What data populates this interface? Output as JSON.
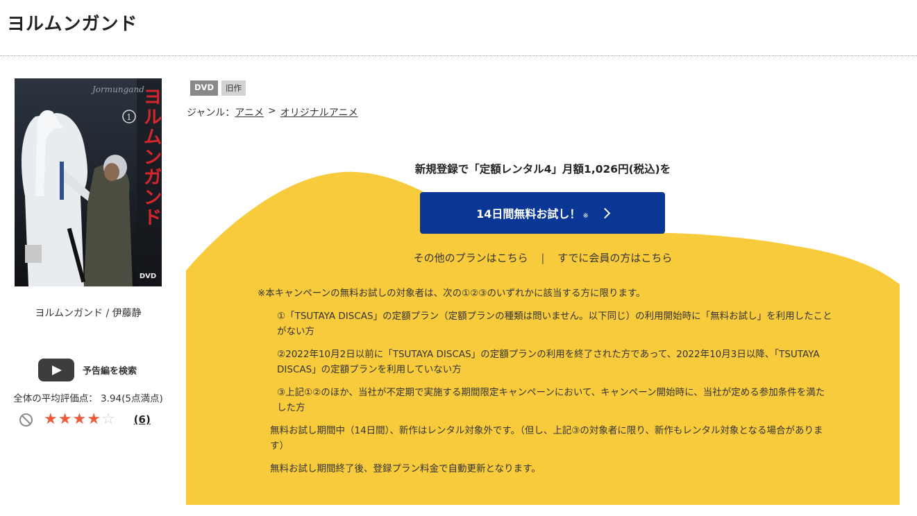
{
  "page": {
    "title": "ヨルムンガンド"
  },
  "jacket": {
    "title_text": "ヨルムンガンド",
    "number": "1",
    "en_text": "Jormungand",
    "dvd_mark": "DVD"
  },
  "work": {
    "credit": "ヨルムンガンド / 伊藤静"
  },
  "trailer": {
    "label": "予告編を検索",
    "icon": "play-icon"
  },
  "rating": {
    "average_label": "全体の平均評価点： 3.94(5点満点)",
    "value": 3.94,
    "max": 5,
    "filled_stars": 4,
    "review_count": "(6)"
  },
  "badges": [
    "DVD",
    "旧作"
  ],
  "genre": {
    "label": "ジャンル：",
    "items": [
      "アニメ",
      "オリジナルアニメ"
    ],
    "separator": ">"
  },
  "promo": {
    "headline": "新規登録で「定額レンタル4」月額1,026円(税込)を",
    "button_label": "14日間無料お試し！",
    "button_note": "※",
    "other_plans": "その他のプランはこちら",
    "separator": "|",
    "members": "すでに会員の方はこちら",
    "accent_color": "#f8cb3c",
    "button_color": "#0a3796"
  },
  "terms": {
    "intro": "※本キャンペーンの無料お試しの対象者は、次の①②③のいずれかに該当する方に限ります。",
    "conditions": [
      "①「TSUTAYA DISCAS」の定額プラン（定額プランの種類は問いません。以下同じ）の利用開始時に「無料お試し」を利用したことがない方",
      "②2022年10月2日以前に「TSUTAYA DISCAS」の定額プランの利用を終了された方であって、2022年10月3日以降、「TSUTAYA DISCAS」の定額プランを利用していない方",
      "③上記①②のほか、当社が不定期で実施する期間限定キャンペーンにおいて、キャンペーン開始時に、当社が定める参加条件を満たした方"
    ],
    "note_trial_period": "無料お試し期間中（14日間）、新作はレンタル対象外です。（但し、上記③の対象者に限り、新作もレンタル対象となる場合があります）",
    "note_after": "無料お試し期間終了後、登録プラン料金で自動更新となります。"
  }
}
